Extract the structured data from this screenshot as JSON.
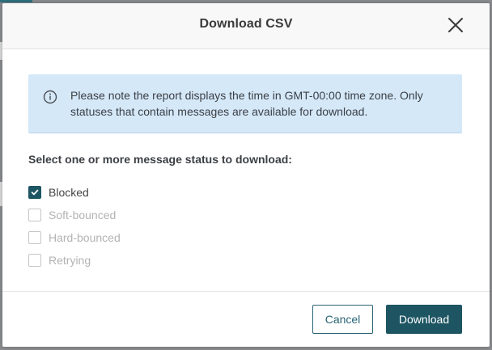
{
  "dialog": {
    "title": "Download CSV",
    "close_icon": "close-icon"
  },
  "notice": {
    "icon": "info-icon",
    "text": "Please note the report displays the time in GMT-00:00 time zone. Only statuses that contain messages are available for download."
  },
  "status_section": {
    "label": "Select one or more message status to download:",
    "options": [
      {
        "label": "Blocked",
        "checked": true,
        "enabled": true
      },
      {
        "label": "Soft-bounced",
        "checked": false,
        "enabled": false
      },
      {
        "label": "Hard-bounced",
        "checked": false,
        "enabled": false
      },
      {
        "label": "Retrying",
        "checked": false,
        "enabled": false
      }
    ]
  },
  "footer": {
    "cancel_label": "Cancel",
    "download_label": "Download"
  },
  "colors": {
    "primary": "#1d5563",
    "notice_bg": "#d5e8f8"
  }
}
